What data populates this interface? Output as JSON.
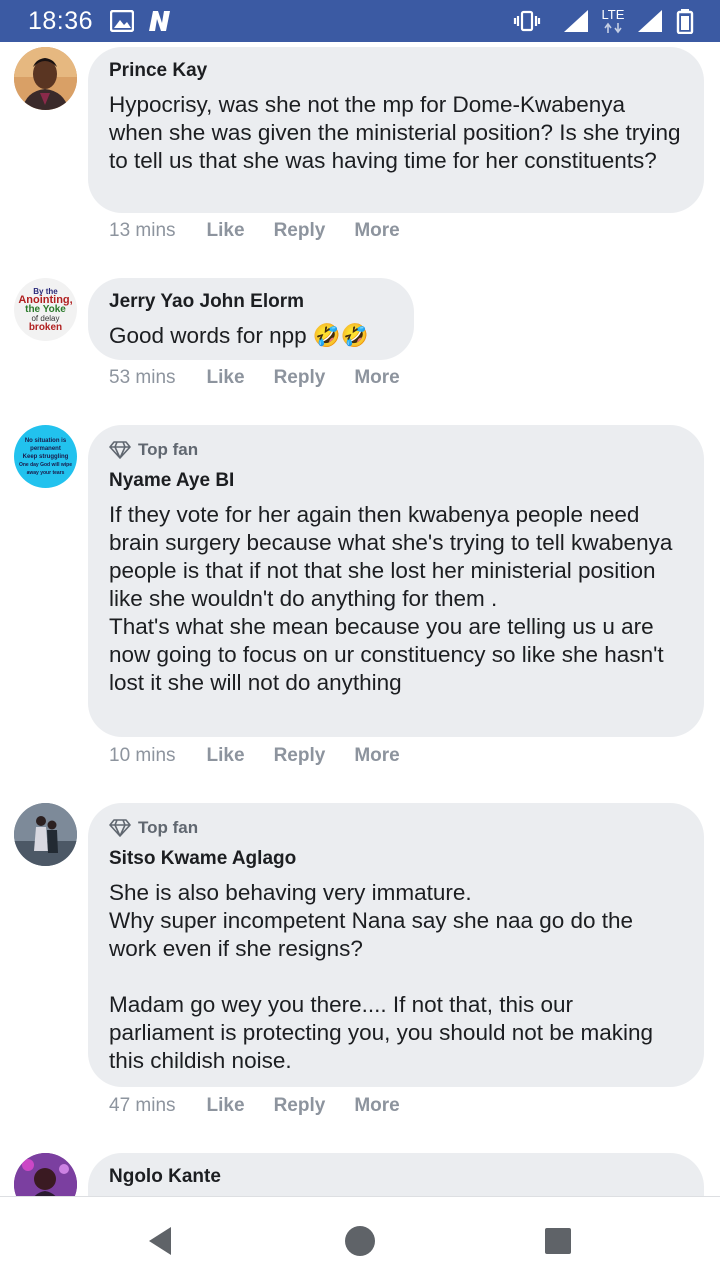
{
  "status_bar": {
    "time": "18:36",
    "lte_label": "LTE",
    "icons": [
      "image-icon",
      "app-n-icon",
      "vibrate-icon",
      "signal-icon",
      "lte-signal-icon",
      "battery-icon"
    ]
  },
  "comments": [
    {
      "author": "Prince Kay",
      "top_fan": "",
      "text": "Hypocrisy, was she not the mp for Dome-Kwabenya when she was given the ministerial position? Is she trying to tell us that she was having time for her constituents?",
      "time": "13 mins",
      "like": "Like",
      "reply": "Reply",
      "more": "More"
    },
    {
      "author": "Jerry Yao John Elorm",
      "top_fan": "",
      "text": "Good words for npp 🤣🤣",
      "time": "53 mins",
      "like": "Like",
      "reply": "Reply",
      "more": "More",
      "avatar_text": [
        "By the",
        "Anointing,",
        "the Yoke",
        "of delay",
        "broken"
      ]
    },
    {
      "author": "Nyame Aye BI",
      "top_fan": "Top fan",
      "text": "If they vote for her again then kwabenya people need brain surgery because what she's trying to tell kwabenya people is that if not that she lost her ministerial position like she wouldn't do anything for them .\nThat's what she mean because you are telling us u are now going to focus on ur constituency so like she hasn't lost it she will not do anything",
      "time": "10 mins",
      "like": "Like",
      "reply": "Reply",
      "more": "More",
      "avatar_text": [
        "No situation is",
        "permanent",
        "Keep struggling",
        "One day God will wipe",
        "away your tears"
      ]
    },
    {
      "author": "Sitso Kwame Aglago",
      "top_fan": "Top fan",
      "text": "She is also behaving very immature.\nWhy super incompetent Nana say she naa go do the work even if she resigns?\n\nMadam go wey you there.... If not that, this our parliament is protecting you, you should not be making this childish noise.",
      "time": "47 mins",
      "like": "Like",
      "reply": "Reply",
      "more": "More"
    },
    {
      "author": "Ngolo Kante",
      "top_fan": "",
      "text": "",
      "time": "",
      "like": "",
      "reply": "",
      "more": ""
    }
  ],
  "colors": {
    "status_bar": "#3b5aa3",
    "bubble": "#ebedf0",
    "meta_text": "#8d949e",
    "name_text": "#1c1e21"
  },
  "nav": {
    "icons": [
      "back-icon",
      "home-icon",
      "recents-icon"
    ]
  }
}
